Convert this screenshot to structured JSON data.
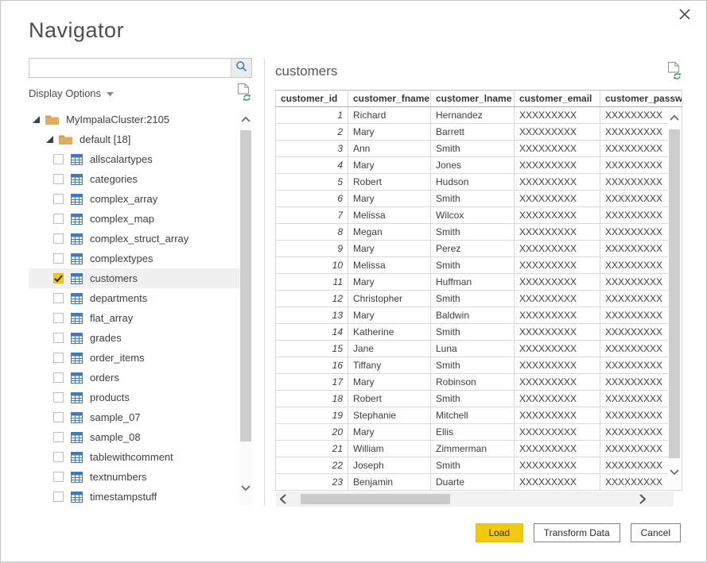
{
  "dialog": {
    "title": "Navigator"
  },
  "search": {
    "value": "",
    "placeholder": ""
  },
  "left_panel": {
    "display_options_label": "Display Options",
    "tree": {
      "root_label": "MyImpalaCluster:2105",
      "schema_label": "default [18]",
      "tables": [
        {
          "label": "allscalartypes",
          "checked": false
        },
        {
          "label": "categories",
          "checked": false
        },
        {
          "label": "complex_array",
          "checked": false
        },
        {
          "label": "complex_map",
          "checked": false
        },
        {
          "label": "complex_struct_array",
          "checked": false
        },
        {
          "label": "complextypes",
          "checked": false
        },
        {
          "label": "customers",
          "checked": true
        },
        {
          "label": "departments",
          "checked": false
        },
        {
          "label": "flat_array",
          "checked": false
        },
        {
          "label": "grades",
          "checked": false
        },
        {
          "label": "order_items",
          "checked": false
        },
        {
          "label": "orders",
          "checked": false
        },
        {
          "label": "products",
          "checked": false
        },
        {
          "label": "sample_07",
          "checked": false
        },
        {
          "label": "sample_08",
          "checked": false
        },
        {
          "label": "tablewithcomment",
          "checked": false
        },
        {
          "label": "textnumbers",
          "checked": false
        },
        {
          "label": "timestampstuff",
          "checked": false
        }
      ]
    }
  },
  "preview": {
    "title": "customers",
    "columns": [
      "customer_id",
      "customer_fname",
      "customer_lname",
      "customer_email",
      "customer_passw"
    ],
    "masked_value": "XXXXXXXXX",
    "rows": [
      [
        1,
        "Richard",
        "Hernandez"
      ],
      [
        2,
        "Mary",
        "Barrett"
      ],
      [
        3,
        "Ann",
        "Smith"
      ],
      [
        4,
        "Mary",
        "Jones"
      ],
      [
        5,
        "Robert",
        "Hudson"
      ],
      [
        6,
        "Mary",
        "Smith"
      ],
      [
        7,
        "Melissa",
        "Wilcox"
      ],
      [
        8,
        "Megan",
        "Smith"
      ],
      [
        9,
        "Mary",
        "Perez"
      ],
      [
        10,
        "Melissa",
        "Smith"
      ],
      [
        11,
        "Mary",
        "Huffman"
      ],
      [
        12,
        "Christopher",
        "Smith"
      ],
      [
        13,
        "Mary",
        "Baldwin"
      ],
      [
        14,
        "Katherine",
        "Smith"
      ],
      [
        15,
        "Jane",
        "Luna"
      ],
      [
        16,
        "Tiffany",
        "Smith"
      ],
      [
        17,
        "Mary",
        "Robinson"
      ],
      [
        18,
        "Robert",
        "Smith"
      ],
      [
        19,
        "Stephanie",
        "Mitchell"
      ],
      [
        20,
        "Mary",
        "Ellis"
      ],
      [
        21,
        "William",
        "Zimmerman"
      ],
      [
        22,
        "Joseph",
        "Smith"
      ],
      [
        23,
        "Benjamin",
        "Duarte"
      ]
    ]
  },
  "footer": {
    "load_label": "Load",
    "transform_label": "Transform Data",
    "cancel_label": "Cancel"
  },
  "colors": {
    "accent_yellow": "#F2C811",
    "table_icon_blue": "#3E7BBE",
    "folder_tan": "#DEAC63",
    "refresh_green": "#3C9E64",
    "selected_row_bg": "#F0F0F0"
  }
}
